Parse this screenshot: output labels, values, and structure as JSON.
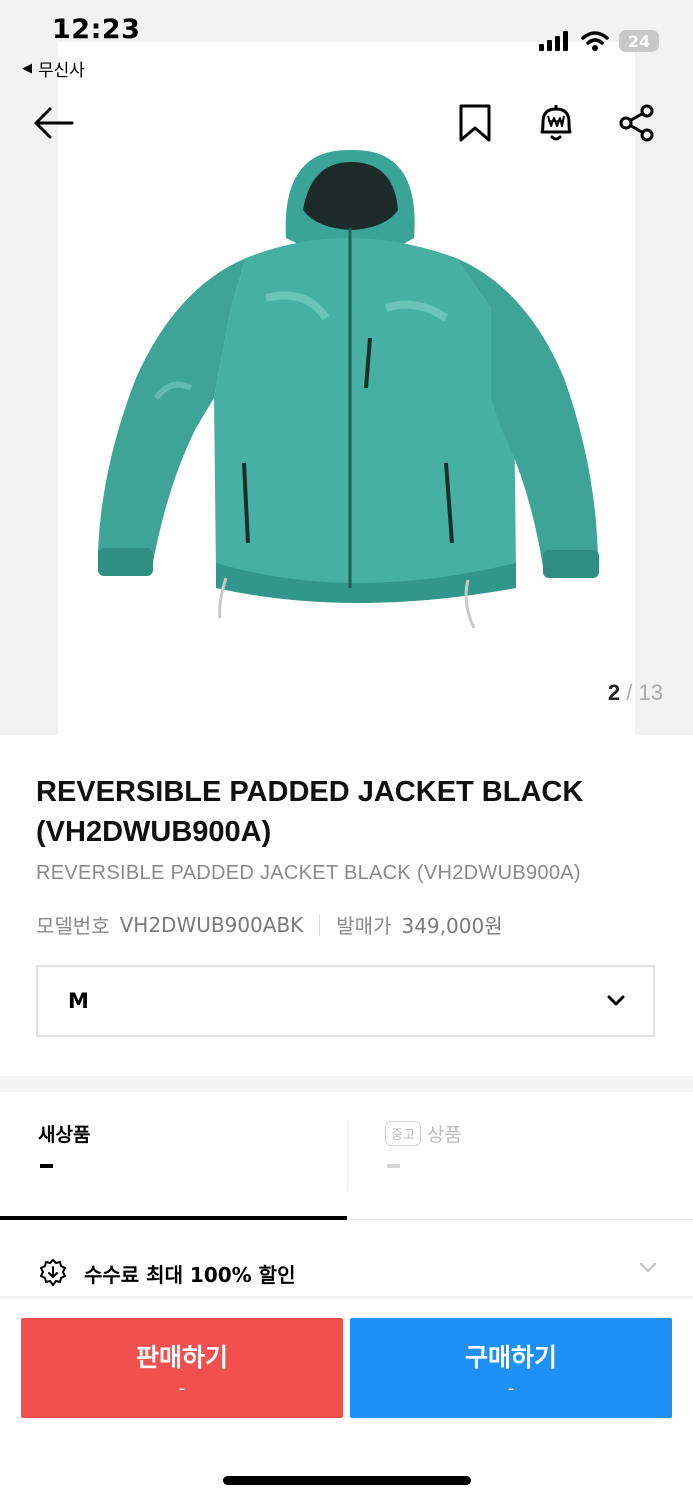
{
  "status_bar": {
    "time": "12:23",
    "back_app": "무신사",
    "battery": "24"
  },
  "gallery": {
    "current": "2",
    "separator": "/",
    "total": "13"
  },
  "product": {
    "title": "REVERSIBLE PADDED JACKET BLACK (VH2DWUB900A)",
    "subtitle": "REVERSIBLE PADDED JACKET BLACK (VH2DWUB900A)",
    "model_label": "모델번호",
    "model_value": "VH2DWUB900ABK",
    "release_label": "발매가",
    "release_value": "349,000원"
  },
  "size_select": {
    "value": "M"
  },
  "tabs": {
    "new": {
      "label": "새상품",
      "value": "-"
    },
    "used": {
      "badge": "중고",
      "label": "상품",
      "value": "-"
    }
  },
  "fee": {
    "label": "수수료 최대 100% 할인"
  },
  "actions": {
    "sell": {
      "label": "판매하기",
      "price": "-"
    },
    "buy": {
      "label": "구매하기",
      "price": "-"
    }
  },
  "colors": {
    "sell": "#f24f4f",
    "buy": "#1e90f5",
    "jacket": "#3fa79a"
  },
  "icons": [
    "back-arrow-icon",
    "bookmark-icon",
    "price-alert-bell-icon",
    "share-icon",
    "chevron-down-icon",
    "discount-badge-icon"
  ]
}
